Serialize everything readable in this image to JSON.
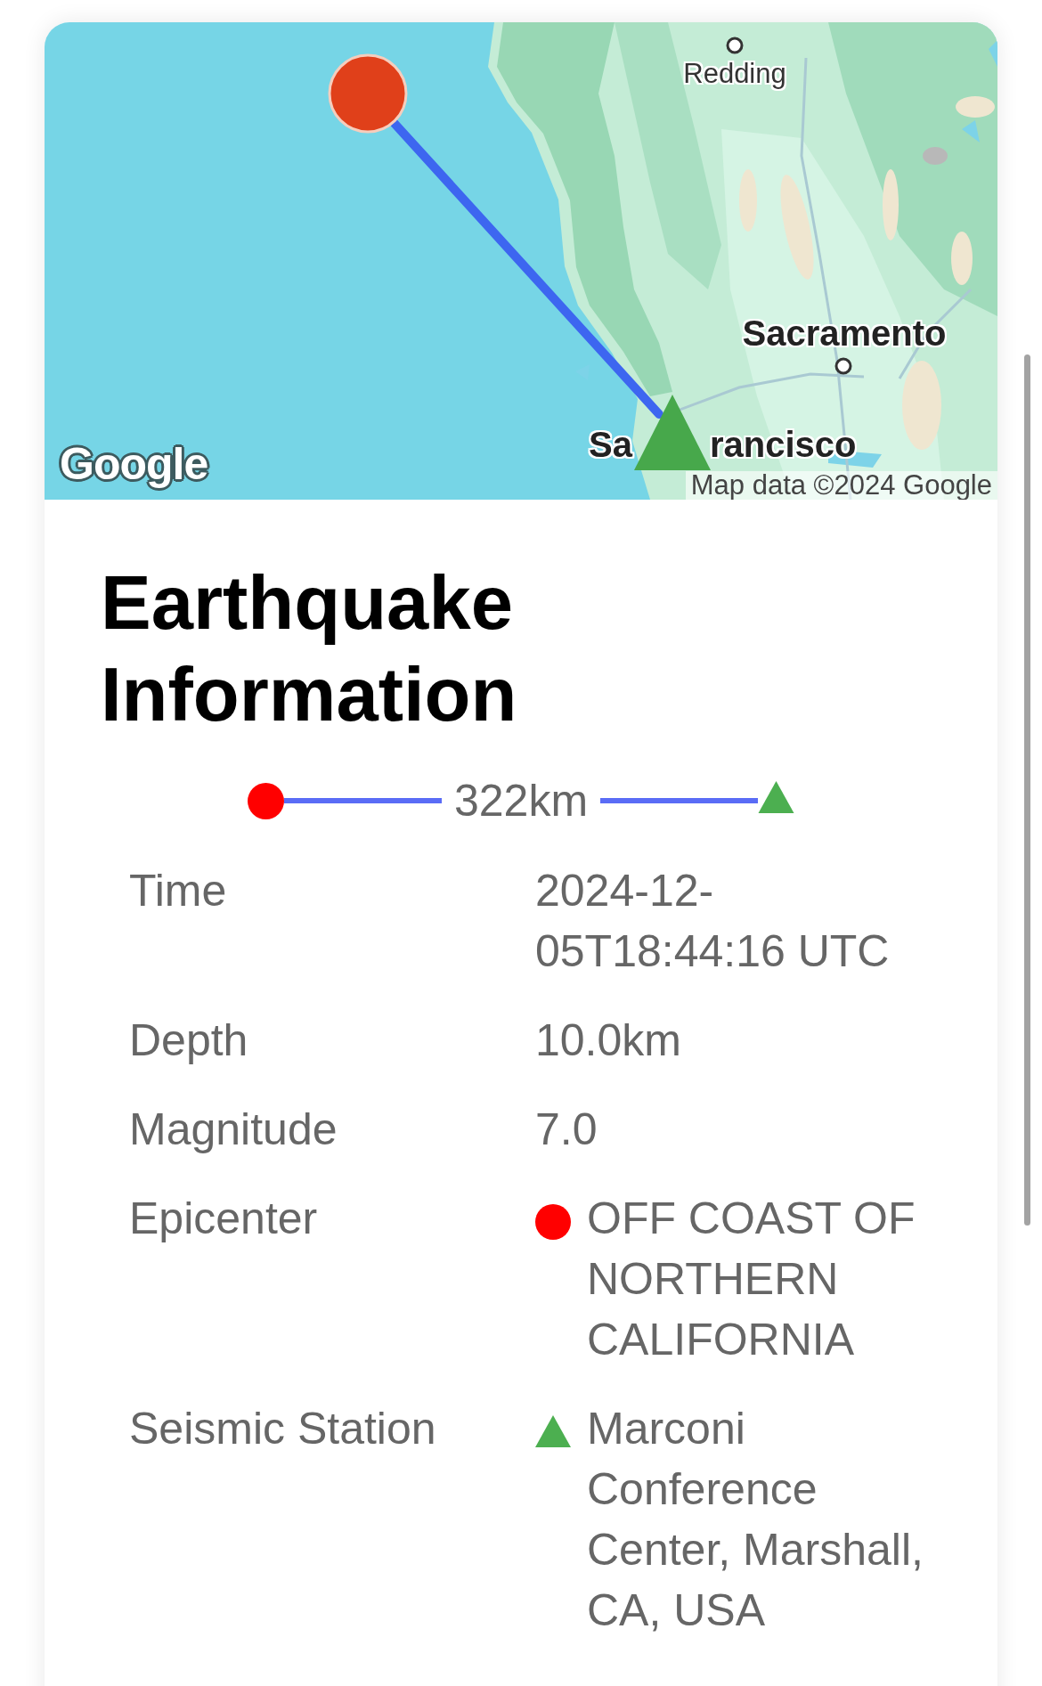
{
  "map": {
    "labels": [
      {
        "text": "Redding",
        "kind": "town"
      },
      {
        "text": "Sacramento",
        "kind": "city"
      },
      {
        "text": "Sa",
        "kind": "city"
      },
      {
        "text": "rancisco",
        "kind": "city"
      }
    ],
    "logo": "Google",
    "attribution": "Map data ©2024 Google"
  },
  "title": "Earthquake Information",
  "distance": "322km",
  "details": [
    {
      "label": "Time",
      "value": "2024-12-05T18:44:16 UTC",
      "kind": "plain"
    },
    {
      "label": "Depth",
      "value": "10.0km",
      "kind": "plain"
    },
    {
      "label": "Magnitude",
      "value": "7.0",
      "kind": "plain"
    },
    {
      "label": "Epicenter",
      "value": "OFF COAST OF NORTHERN CALIFORNIA",
      "kind": "epicenter"
    },
    {
      "label": "Seismic Station",
      "value": "Marconi Conference Center, Marshall, CA, USA",
      "kind": "station"
    }
  ]
}
